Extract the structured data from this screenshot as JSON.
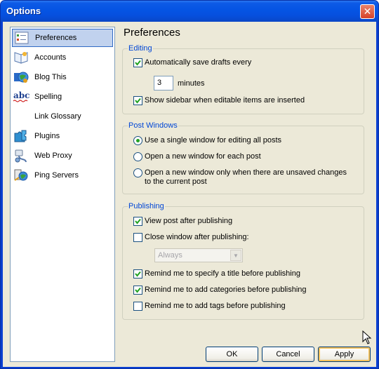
{
  "window": {
    "title": "Options",
    "close_glyph": "✕"
  },
  "sidebar": {
    "items": [
      {
        "label": "Preferences",
        "icon": "preferences-icon",
        "selected": true
      },
      {
        "label": "Accounts",
        "icon": "accounts-icon"
      },
      {
        "label": "Blog This",
        "icon": "blog-this-icon"
      },
      {
        "label": "Spelling",
        "icon": "spelling-icon"
      },
      {
        "label": "Link Glossary",
        "icon": "link-glossary-icon"
      },
      {
        "label": "Plugins",
        "icon": "plugins-icon"
      },
      {
        "label": "Web Proxy",
        "icon": "web-proxy-icon"
      },
      {
        "label": "Ping Servers",
        "icon": "ping-servers-icon"
      }
    ]
  },
  "panel": {
    "title": "Preferences"
  },
  "editing": {
    "title": "Editing",
    "auto_save": {
      "label": "Automatically save drafts every",
      "checked": true
    },
    "minutes_value": "3",
    "minutes_label": "minutes",
    "show_sidebar": {
      "label": "Show sidebar when editable items are inserted",
      "checked": true
    }
  },
  "post_windows": {
    "title": "Post Windows",
    "options": [
      {
        "label": "Use a single window for editing all posts",
        "selected": true
      },
      {
        "label": "Open a new window for each post",
        "selected": false
      },
      {
        "label": "Open a new window only when there are unsaved changes to the current post",
        "selected": false
      }
    ]
  },
  "publishing": {
    "title": "Publishing",
    "view_post": {
      "label": "View post after publishing",
      "checked": true
    },
    "close_window": {
      "label": "Close window after publishing:",
      "checked": false
    },
    "close_select_value": "Always",
    "remind_title": {
      "label": "Remind me to specify a title before publishing",
      "checked": true
    },
    "remind_categories": {
      "label": "Remind me to add categories before publishing",
      "checked": true
    },
    "remind_tags": {
      "label": "Remind me to add tags before publishing",
      "checked": false
    }
  },
  "buttons": {
    "ok": "OK",
    "cancel": "Cancel",
    "apply": "Apply"
  },
  "colors": {
    "title_bar": "#0554e3",
    "group_title": "#0046d5",
    "selection": "#c1d2ee",
    "dialog_bg": "#ece9d8"
  }
}
